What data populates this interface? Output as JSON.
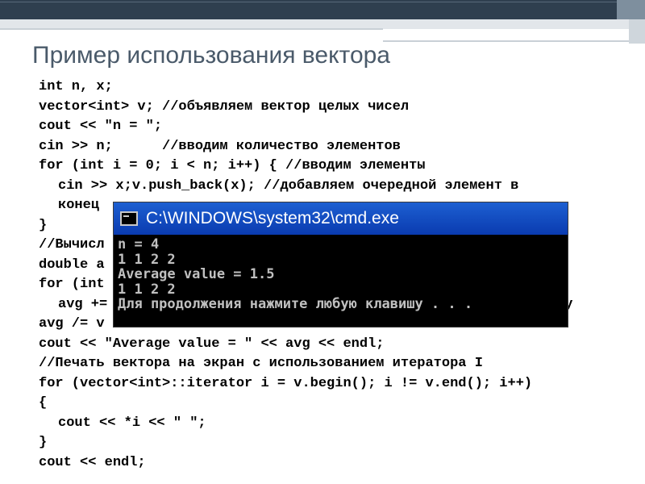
{
  "slide": {
    "title": "Пример использования вектора"
  },
  "code": {
    "lines": [
      "int n, x;",
      "vector<int> v; //объявляем вектор целых чисел",
      "cout << \"n = \";",
      "cin >> n;      //вводим количество элементов",
      "for (int i = 0; i < n; i++) { //вводим элементы",
      "cin >> x;v.push_back(x); //добавляем очередной элемент в",
      "конец",
      "}",
      "//Вычисл",
      "double a",
      "for (int",
      "avg +=",
      "avg /= v",
      "cout << \"Average value = \" << avg << endl;",
      "//Печать вектора на экран с использованием итератора I",
      "for (vector<int>::iterator i = v.begin(); i != v.end(); i++)",
      "{",
      "cout << *i << \" \";",
      "}",
      "cout << endl;"
    ],
    "hidden_tail": "су"
  },
  "console": {
    "title": "C:\\WINDOWS\\system32\\cmd.exe",
    "icon": "console-icon",
    "lines": [
      "n = 4",
      "1 1 2 2",
      "Average value = 1.5",
      "1 1 2 2",
      "Для продолжения нажмите любую клавишу . . ."
    ]
  },
  "colors": {
    "title": "#4a5a6a",
    "topbar": "#2f3f4f",
    "console_titlebar": "#0a3bb0",
    "console_text": "#c0c0c0"
  }
}
